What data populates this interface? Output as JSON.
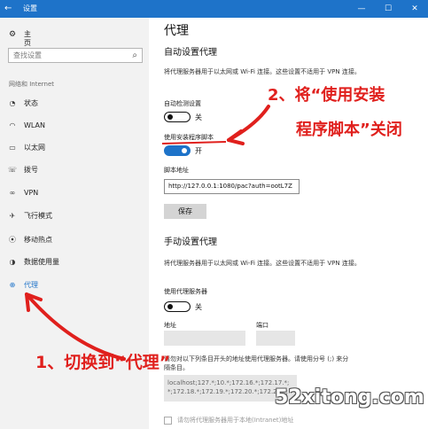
{
  "window": {
    "back_icon": "back-arrow-icon",
    "title": "设置",
    "minimize": "—",
    "maximize": "☐",
    "close": "✕"
  },
  "sidebar": {
    "home": "主页",
    "search_placeholder": "查找设置",
    "section": "网络和 Internet",
    "items": [
      {
        "label": "状态",
        "icon": "status-icon",
        "glyph": "◔"
      },
      {
        "label": "WLAN",
        "icon": "wifi-icon",
        "glyph": "◠"
      },
      {
        "label": "以太网",
        "icon": "ethernet-icon",
        "glyph": "▭"
      },
      {
        "label": "拨号",
        "icon": "dialup-icon",
        "glyph": "☏"
      },
      {
        "label": "VPN",
        "icon": "vpn-icon",
        "glyph": "∞"
      },
      {
        "label": "飞行模式",
        "icon": "airplane-icon",
        "glyph": "✈"
      },
      {
        "label": "移动热点",
        "icon": "hotspot-icon",
        "glyph": "⦿"
      },
      {
        "label": "数据使用量",
        "icon": "data-usage-icon",
        "glyph": "◑"
      },
      {
        "label": "代理",
        "icon": "globe-icon",
        "glyph": "⊕",
        "active": true
      }
    ]
  },
  "content": {
    "title": "代理",
    "auto": {
      "heading": "自动设置代理",
      "desc": "将代理服务器用于以太网或 Wi-Fi 连接。这些设置不适用于 VPN 连接。",
      "detect_label": "自动检测设置",
      "detect_state": "关",
      "script_label": "使用安装程序脚本",
      "script_state": "开",
      "address_label": "脚本地址",
      "address_value": "http://127.0.0.1:1080/pac?auth=ootL7Z",
      "save": "保存"
    },
    "manual": {
      "heading": "手动设置代理",
      "desc": "将代理服务器用于以太网或 Wi-Fi 连接。这些设置不适用于 VPN 连接。",
      "use_label": "使用代理服务器",
      "use_state": "关",
      "address_label": "地址",
      "port_label": "端口",
      "exceptions_desc_1": "请勿对以下列条目开头的地址使用代理服务器。请使用分号 (;) 来分",
      "exceptions_desc_2": "隔条目。",
      "exceptions_value_1": "localhost;127.*;10.*;172.16.*;172.17.*;",
      "exceptions_value_2": "*;172.18.*;172.19.*;172.20.*;172.21.*;",
      "local_checkbox": "请勿将代理服务器用于本地(Intranet)地址"
    }
  },
  "annotations": {
    "step1": "1、切换到“代理”",
    "step2_line1": "2、将“使用安装",
    "step2_line2": "程序脚本”关闭",
    "color": "#e0201d"
  },
  "watermark": "52xitong.com"
}
